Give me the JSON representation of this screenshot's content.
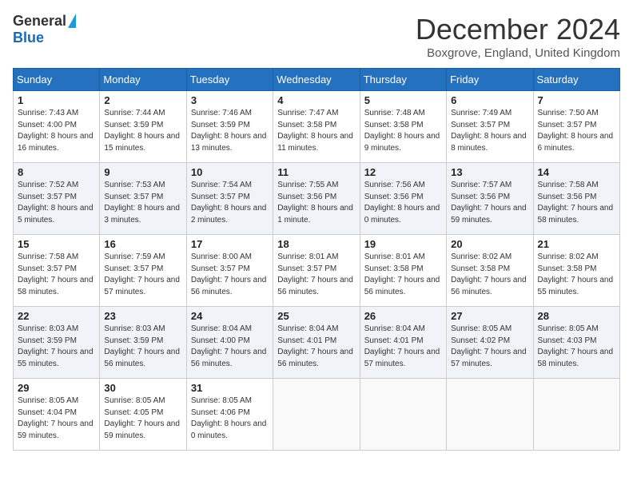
{
  "header": {
    "logo_general": "General",
    "logo_blue": "Blue",
    "title": "December 2024",
    "location": "Boxgrove, England, United Kingdom"
  },
  "calendar": {
    "days_of_week": [
      "Sunday",
      "Monday",
      "Tuesday",
      "Wednesday",
      "Thursday",
      "Friday",
      "Saturday"
    ],
    "weeks": [
      [
        {
          "day": "1",
          "sunrise": "7:43 AM",
          "sunset": "4:00 PM",
          "daylight": "8 hours and 16 minutes."
        },
        {
          "day": "2",
          "sunrise": "7:44 AM",
          "sunset": "3:59 PM",
          "daylight": "8 hours and 15 minutes."
        },
        {
          "day": "3",
          "sunrise": "7:46 AM",
          "sunset": "3:59 PM",
          "daylight": "8 hours and 13 minutes."
        },
        {
          "day": "4",
          "sunrise": "7:47 AM",
          "sunset": "3:58 PM",
          "daylight": "8 hours and 11 minutes."
        },
        {
          "day": "5",
          "sunrise": "7:48 AM",
          "sunset": "3:58 PM",
          "daylight": "8 hours and 9 minutes."
        },
        {
          "day": "6",
          "sunrise": "7:49 AM",
          "sunset": "3:57 PM",
          "daylight": "8 hours and 8 minutes."
        },
        {
          "day": "7",
          "sunrise": "7:50 AM",
          "sunset": "3:57 PM",
          "daylight": "8 hours and 6 minutes."
        }
      ],
      [
        {
          "day": "8",
          "sunrise": "7:52 AM",
          "sunset": "3:57 PM",
          "daylight": "8 hours and 5 minutes."
        },
        {
          "day": "9",
          "sunrise": "7:53 AM",
          "sunset": "3:57 PM",
          "daylight": "8 hours and 3 minutes."
        },
        {
          "day": "10",
          "sunrise": "7:54 AM",
          "sunset": "3:57 PM",
          "daylight": "8 hours and 2 minutes."
        },
        {
          "day": "11",
          "sunrise": "7:55 AM",
          "sunset": "3:56 PM",
          "daylight": "8 hours and 1 minute."
        },
        {
          "day": "12",
          "sunrise": "7:56 AM",
          "sunset": "3:56 PM",
          "daylight": "8 hours and 0 minutes."
        },
        {
          "day": "13",
          "sunrise": "7:57 AM",
          "sunset": "3:56 PM",
          "daylight": "7 hours and 59 minutes."
        },
        {
          "day": "14",
          "sunrise": "7:58 AM",
          "sunset": "3:56 PM",
          "daylight": "7 hours and 58 minutes."
        }
      ],
      [
        {
          "day": "15",
          "sunrise": "7:58 AM",
          "sunset": "3:57 PM",
          "daylight": "7 hours and 58 minutes."
        },
        {
          "day": "16",
          "sunrise": "7:59 AM",
          "sunset": "3:57 PM",
          "daylight": "7 hours and 57 minutes."
        },
        {
          "day": "17",
          "sunrise": "8:00 AM",
          "sunset": "3:57 PM",
          "daylight": "7 hours and 56 minutes."
        },
        {
          "day": "18",
          "sunrise": "8:01 AM",
          "sunset": "3:57 PM",
          "daylight": "7 hours and 56 minutes."
        },
        {
          "day": "19",
          "sunrise": "8:01 AM",
          "sunset": "3:58 PM",
          "daylight": "7 hours and 56 minutes."
        },
        {
          "day": "20",
          "sunrise": "8:02 AM",
          "sunset": "3:58 PM",
          "daylight": "7 hours and 56 minutes."
        },
        {
          "day": "21",
          "sunrise": "8:02 AM",
          "sunset": "3:58 PM",
          "daylight": "7 hours and 55 minutes."
        }
      ],
      [
        {
          "day": "22",
          "sunrise": "8:03 AM",
          "sunset": "3:59 PM",
          "daylight": "7 hours and 55 minutes."
        },
        {
          "day": "23",
          "sunrise": "8:03 AM",
          "sunset": "3:59 PM",
          "daylight": "7 hours and 56 minutes."
        },
        {
          "day": "24",
          "sunrise": "8:04 AM",
          "sunset": "4:00 PM",
          "daylight": "7 hours and 56 minutes."
        },
        {
          "day": "25",
          "sunrise": "8:04 AM",
          "sunset": "4:01 PM",
          "daylight": "7 hours and 56 minutes."
        },
        {
          "day": "26",
          "sunrise": "8:04 AM",
          "sunset": "4:01 PM",
          "daylight": "7 hours and 57 minutes."
        },
        {
          "day": "27",
          "sunrise": "8:05 AM",
          "sunset": "4:02 PM",
          "daylight": "7 hours and 57 minutes."
        },
        {
          "day": "28",
          "sunrise": "8:05 AM",
          "sunset": "4:03 PM",
          "daylight": "7 hours and 58 minutes."
        }
      ],
      [
        {
          "day": "29",
          "sunrise": "8:05 AM",
          "sunset": "4:04 PM",
          "daylight": "7 hours and 59 minutes."
        },
        {
          "day": "30",
          "sunrise": "8:05 AM",
          "sunset": "4:05 PM",
          "daylight": "7 hours and 59 minutes."
        },
        {
          "day": "31",
          "sunrise": "8:05 AM",
          "sunset": "4:06 PM",
          "daylight": "8 hours and 0 minutes."
        },
        null,
        null,
        null,
        null
      ]
    ]
  }
}
